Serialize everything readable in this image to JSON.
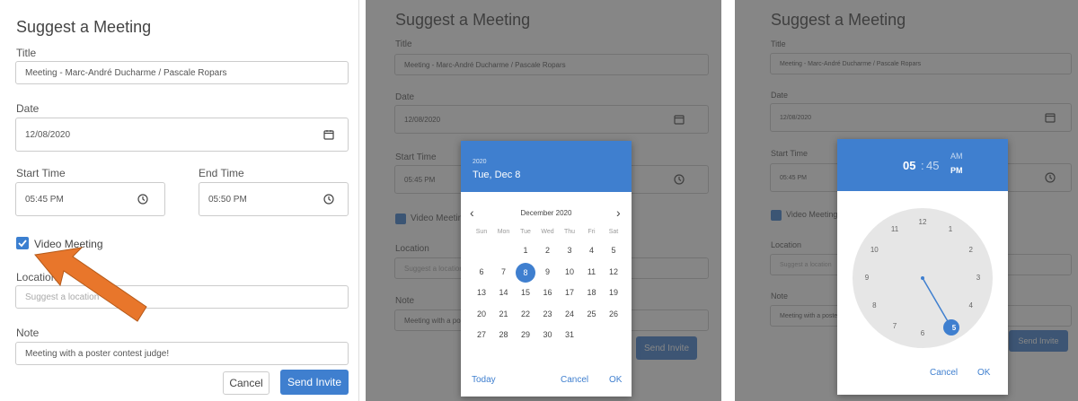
{
  "form": {
    "heading": "Suggest a Meeting",
    "title_label": "Title",
    "title_value": "Meeting - Marc-André Ducharme / Pascale Ropars",
    "date_label": "Date",
    "date_value": "12/08/2020",
    "start_label": "Start Time",
    "start_value": "05:45 PM",
    "end_label": "End Time",
    "end_value": "05:50 PM",
    "video_label": "Video Meeting",
    "location_label": "Location",
    "location_placeholder": "Suggest a location",
    "note_label": "Note",
    "note_value": "Meeting with a poster contest judge!",
    "cancel_label": "Cancel",
    "send_label": "Send Invite"
  },
  "calendar": {
    "year": "2020",
    "selected_text": "Tue, Dec 8",
    "month_label": "December 2020",
    "prev_icon": "‹",
    "next_icon": "›",
    "dow": [
      "Sun",
      "Mon",
      "Tue",
      "Wed",
      "Thu",
      "Fri",
      "Sat"
    ],
    "weeks": [
      [
        "",
        "",
        "1",
        "2",
        "3",
        "4",
        "5"
      ],
      [
        "6",
        "7",
        "8",
        "9",
        "10",
        "11",
        "12"
      ],
      [
        "13",
        "14",
        "15",
        "16",
        "17",
        "18",
        "19"
      ],
      [
        "20",
        "21",
        "22",
        "23",
        "24",
        "25",
        "26"
      ],
      [
        "27",
        "28",
        "29",
        "30",
        "31",
        "",
        ""
      ]
    ],
    "selected_day": "8",
    "today_label": "Today",
    "cancel_label": "Cancel",
    "ok_label": "OK"
  },
  "clock": {
    "hour": "05",
    "separator": ":",
    "minute": "45",
    "am": "AM",
    "pm": "PM",
    "numbers": [
      "12",
      "1",
      "2",
      "3",
      "4",
      "5",
      "6",
      "7",
      "8",
      "9",
      "10",
      "11"
    ],
    "selected": "5",
    "cancel_label": "Cancel",
    "ok_label": "OK"
  },
  "colors": {
    "accent": "#3f7fcf",
    "arrow": "#e8762b"
  }
}
